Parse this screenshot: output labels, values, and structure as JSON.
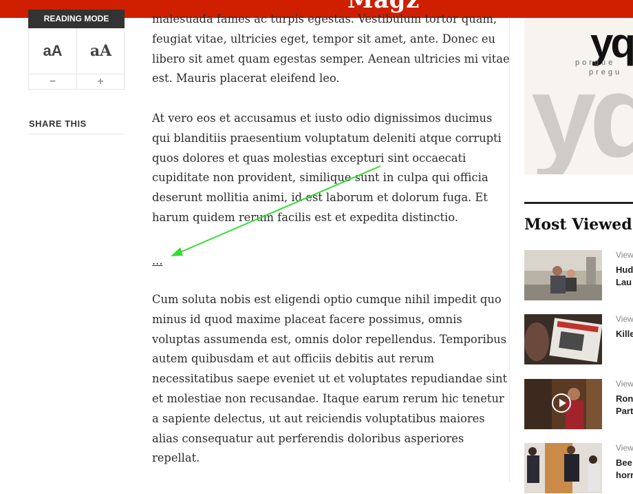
{
  "header": {
    "brand": "Magz",
    "color": "#d01e00"
  },
  "reading_mode": {
    "title": "READING MODE",
    "font_options": [
      "aA",
      "aA"
    ],
    "decrease_label": "−",
    "increase_label": "+"
  },
  "share": {
    "label": "SHARE THIS"
  },
  "article": {
    "p1_lines": [
      "malesuada fames ac turpis egestas. Vestibulum tortor quam,",
      "feugiat vitae, ultricies eget, tempor sit amet, ante. Donec eu",
      "libero sit amet quam egestas semper. Aenean ultricies mi vitae",
      "est. Mauris placerat eleifend leo."
    ],
    "p2_lines": [
      "At vero eos et accusamus et iusto odio dignissimos ducimus",
      "qui blanditiis praesentium voluptatum deleniti atque corrupti",
      "quos dolores et quas molestias excepturi sint occaecati",
      "cupiditate non provident, similique sunt in culpa qui officia",
      "deserunt mollitia animi, id est laborum et dolorum fuga. Et",
      "harum quidem rerum facilis est et expedita distinctio."
    ],
    "ellipsis": "...",
    "p3_lines": [
      "Cum soluta nobis est eligendi optio cumque nihil impedit quo",
      "minus id quod maxime placeat facere possimus, omnis",
      "voluptas assumenda est, omnis dolor repellendus. Temporibus",
      "autem quibusdam et aut officiis debitis aut rerum",
      "necessitatibus saepe eveniet ut et voluptates repudiandae sint",
      "et molestiae non recusandae. Itaque earum rerum hic tenetur",
      "a sapiente delectus, ut aut reiciendis voluptatibus maiores",
      "alias consequatur aut perferendis doloribus asperiores",
      "repellat."
    ]
  },
  "ad": {
    "logo": "yq",
    "tagline_1": "porque",
    "tagline_2": "pregu"
  },
  "most_viewed": {
    "title": "Most Viewed",
    "items": [
      {
        "views": "View",
        "headline_1": "Hud",
        "headline_2": "Lau"
      },
      {
        "views": "View",
        "headline_1": "Kille",
        "headline_2": ""
      },
      {
        "views": "View",
        "headline_1": "Ron",
        "headline_2": "Part"
      },
      {
        "views": "View",
        "headline_1": "Bee",
        "headline_2": "horr"
      }
    ]
  },
  "annotation": {
    "color": "#33dd33",
    "icon": "arrow-annotation"
  }
}
